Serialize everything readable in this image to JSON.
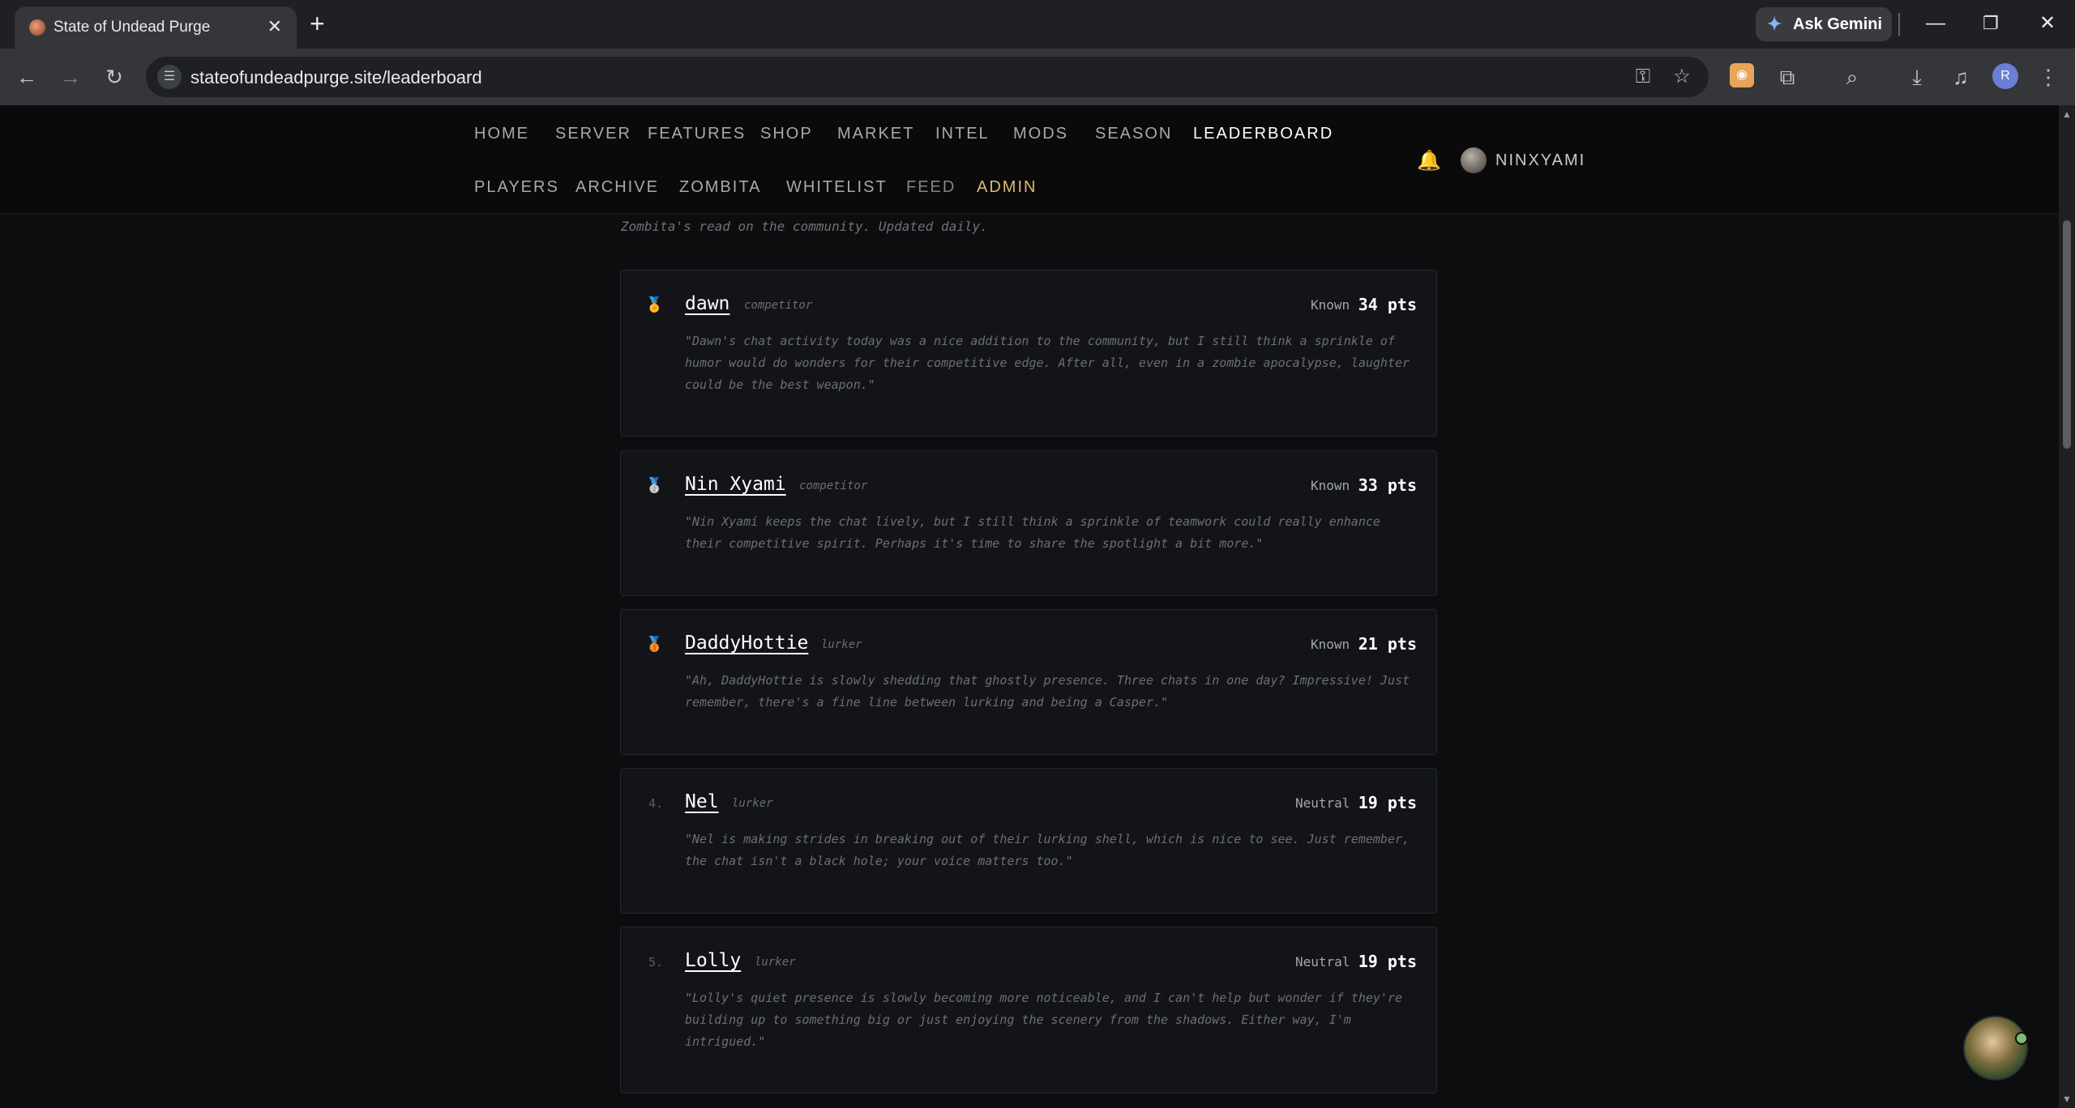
{
  "browser": {
    "tab_title": "State of Undead Purge",
    "close_glyph": "✕",
    "new_tab_glyph": "+",
    "gemini_label": "Ask Gemini",
    "url": "stateofundeadpurge.site/leaderboard",
    "profile_initial": "R"
  },
  "nav": {
    "row1": [
      "HOME",
      "SERVER",
      "FEATURES",
      "SHOP",
      "MARKET",
      "INTEL",
      "MODS",
      "SEASON",
      "LEADERBOARD"
    ],
    "row2": [
      "PLAYERS",
      "ARCHIVE",
      "ZOMBITA",
      "WHITELIST",
      "FEED",
      "ADMIN"
    ],
    "active": "LEADERBOARD",
    "username": "NINXYAMI"
  },
  "subtitle": "Zombita's read on the community. Updated daily.",
  "entries": [
    {
      "rank": "1.",
      "medal": "gold",
      "name": "dawn",
      "role": "competitor",
      "standing": "Known",
      "points": "34 pts",
      "quote": "\"Dawn's chat activity today was a nice addition to the community, but I still think a sprinkle of humor would do wonders for their competitive edge. After all, even in a zombie apocalypse, laughter could be the best weapon.\""
    },
    {
      "rank": "2.",
      "medal": "silver",
      "name": "Nin Xyami",
      "role": "competitor",
      "standing": "Known",
      "points": "33 pts",
      "quote": "\"Nin Xyami keeps the chat lively, but I still think a sprinkle of teamwork could really enhance their competitive spirit. Perhaps it's time to share the spotlight a bit more.\""
    },
    {
      "rank": "3.",
      "medal": "bronze",
      "name": "DaddyHottie",
      "role": "lurker",
      "standing": "Known",
      "points": "21 pts",
      "quote": "\"Ah, DaddyHottie is slowly shedding that ghostly presence. Three chats in one day? Impressive! Just remember, there's a fine line between lurking and being a Casper.\""
    },
    {
      "rank": "4.",
      "medal": "",
      "name": "Nel",
      "role": "lurker",
      "standing": "Neutral",
      "points": "19 pts",
      "quote": "\"Nel is making strides in breaking out of their lurking shell, which is nice to see. Just remember, the chat isn't a black hole; your voice matters too.\""
    },
    {
      "rank": "5.",
      "medal": "",
      "name": "Lolly",
      "role": "lurker",
      "standing": "Neutral",
      "points": "19 pts",
      "quote": "\"Lolly's quiet presence is slowly becoming more noticeable, and I can't help but wonder if they're building up to something big or just enjoying the scenery from the shadows. Either way, I'm intrigued.\""
    }
  ],
  "colors": {
    "page_bg": "#0c0d0e",
    "card_bg": "#121418",
    "admin": "#e0b872",
    "bell": "#f0b429"
  }
}
